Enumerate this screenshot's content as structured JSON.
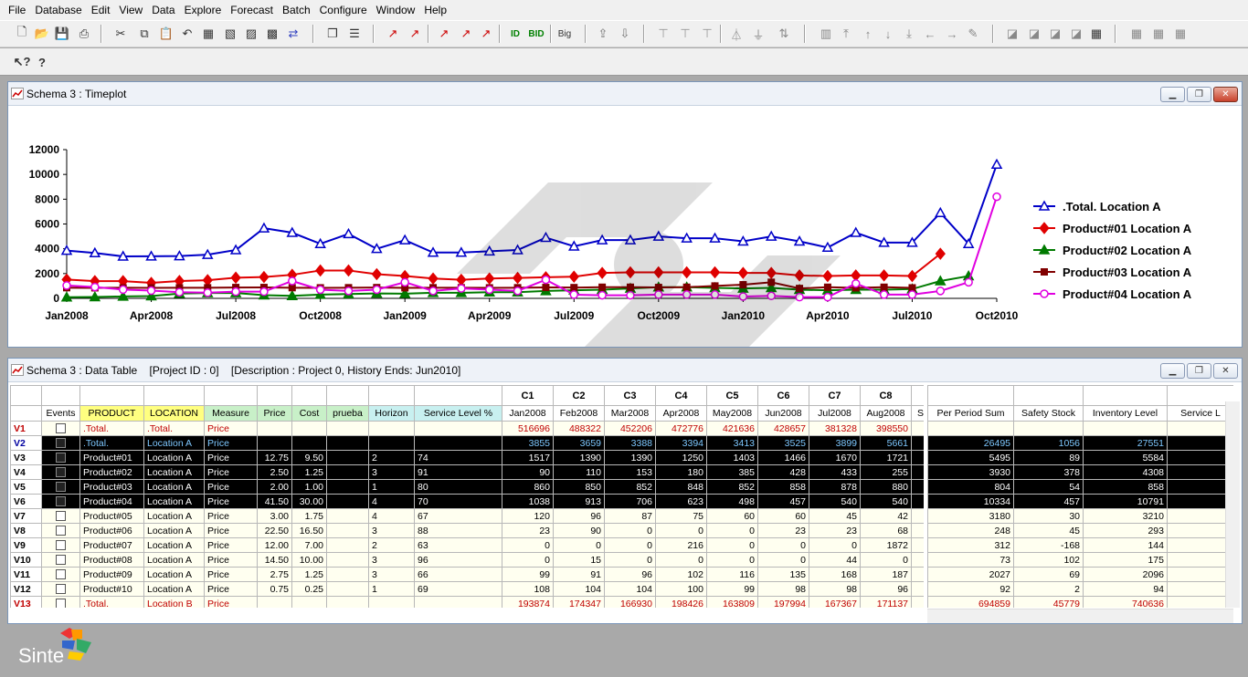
{
  "menu": [
    "File",
    "Database",
    "Edit",
    "View",
    "Data",
    "Explore",
    "Forecast",
    "Batch",
    "Configure",
    "Window",
    "Help"
  ],
  "toolbar": {
    "big_label": "Big"
  },
  "chart_window": {
    "title": "Schema 3 : Timeplot"
  },
  "table_window": {
    "title": "Schema 3 : Data Table    [Project ID : 0]    [Description : Project 0, History Ends: Jun2010]"
  },
  "window_buttons": {
    "minimize": "▁",
    "maximize": "❐",
    "close": "✕"
  },
  "chart_data": {
    "type": "line",
    "x": [
      "Jan2008",
      "Feb2008",
      "Mar2008",
      "Apr2008",
      "May2008",
      "Jun2008",
      "Jul2008",
      "Aug2008",
      "Sep2008",
      "Oct2008",
      "Nov2008",
      "Dec2008",
      "Jan2009",
      "Feb2009",
      "Mar2009",
      "Apr2009",
      "May2009",
      "Jun2009",
      "Jul2009",
      "Aug2009",
      "Sep2009",
      "Oct2009",
      "Nov2009",
      "Dec2009",
      "Jan2010",
      "Feb2010",
      "Mar2010",
      "Apr2010",
      "May2010",
      "Jun2010",
      "Jul2010",
      "Aug2010",
      "Sep2010",
      "Oct2010"
    ],
    "xticks": [
      "Jan2008",
      "Apr2008",
      "Jul2008",
      "Oct2008",
      "Jan2009",
      "Apr2009",
      "Jul2009",
      "Oct2009",
      "Jan2010",
      "Apr2010",
      "Jul2010",
      "Oct2010"
    ],
    "ylim": [
      0,
      12000
    ],
    "yticks": [
      "0",
      "2000",
      "4000",
      "6000",
      "8000",
      "10000",
      "12000"
    ],
    "legend_position": "right",
    "series": [
      {
        "name": ".Total. Location A",
        "color": "#0000c8",
        "marker": "triangle",
        "values": [
          3855,
          3659,
          3388,
          3394,
          3413,
          3525,
          3899,
          5661,
          5300,
          4400,
          5200,
          4000,
          4700,
          3700,
          3700,
          3800,
          3900,
          4900,
          4200,
          4700,
          4700,
          5000,
          4850,
          4850,
          4600,
          5000,
          4600,
          4100,
          5300,
          4500,
          4500,
          6900,
          4400,
          10800
        ]
      },
      {
        "name": "Product#01 Location A",
        "color": "#e00000",
        "marker": "diamond",
        "values": [
          1517,
          1390,
          1390,
          1250,
          1403,
          1466,
          1670,
          1721,
          1900,
          2250,
          2250,
          1950,
          1800,
          1600,
          1500,
          1600,
          1650,
          1700,
          1750,
          2050,
          2100,
          2100,
          2100,
          2100,
          2050,
          2050,
          1850,
          1800,
          1850,
          1850,
          1800,
          3600,
          null,
          null
        ]
      },
      {
        "name": "Product#02 Location A",
        "color": "#007a00",
        "marker": "triangle",
        "values": [
          90,
          110,
          153,
          180,
          385,
          428,
          433,
          255,
          200,
          300,
          350,
          400,
          380,
          450,
          450,
          500,
          500,
          600,
          650,
          700,
          800,
          900,
          900,
          850,
          800,
          850,
          700,
          650,
          700,
          700,
          750,
          1400,
          1800,
          null
        ]
      },
      {
        "name": "Product#03 Location A",
        "color": "#800000",
        "marker": "square",
        "values": [
          860,
          850,
          852,
          848,
          852,
          858,
          878,
          880,
          860,
          850,
          860,
          870,
          850,
          860,
          860,
          850,
          860,
          880,
          870,
          900,
          900,
          880,
          900,
          1000,
          1100,
          1300,
          800,
          900,
          850,
          900,
          850,
          null,
          null,
          null
        ]
      },
      {
        "name": "Product#04 Location A",
        "color": "#e000e0",
        "marker": "circle",
        "values": [
          1038,
          913,
          706,
          623,
          498,
          457,
          540,
          540,
          1400,
          700,
          600,
          700,
          1300,
          600,
          800,
          700,
          600,
          1500,
          300,
          250,
          250,
          300,
          300,
          300,
          150,
          200,
          100,
          100,
          1200,
          300,
          300,
          600,
          1300,
          8200
        ]
      }
    ]
  },
  "table": {
    "col_letters": [
      "",
      "",
      "",
      "",
      "",
      "",
      "",
      "",
      "",
      "",
      "C1",
      "C2",
      "C3",
      "C4",
      "C5",
      "C6",
      "C7",
      "C8",
      ""
    ],
    "headers": [
      "",
      "Events",
      "PRODUCT",
      "LOCATION",
      "Measure",
      "Price",
      "Cost",
      "prueba",
      "Horizon",
      "Service Level %",
      "Jan2008",
      "Feb2008",
      "Mar2008",
      "Apr2008",
      "May2008",
      "Jun2008",
      "Jul2008",
      "Aug2008",
      "S"
    ],
    "right_headers": [
      "Per Period Sum",
      "Safety Stock",
      "Inventory Level",
      "Service L"
    ],
    "rows": [
      {
        "id": "V1",
        "style": "red",
        "cells": [
          ".Total.",
          ".Total.",
          "Price",
          "",
          "",
          "",
          "",
          "",
          "516696",
          "488322",
          "452206",
          "472776",
          "421636",
          "428657",
          "381328",
          "398550"
        ],
        "right": [
          "",
          "",
          "",
          ""
        ]
      },
      {
        "id": "V2",
        "style": "sel",
        "cells": [
          ".Total.",
          "Location A",
          "Price",
          "",
          "",
          "",
          "",
          "",
          "3855",
          "3659",
          "3388",
          "3394",
          "3413",
          "3525",
          "3899",
          "5661"
        ],
        "right": [
          "26495",
          "1056",
          "27551",
          ""
        ]
      },
      {
        "id": "V3",
        "style": "dark",
        "cells": [
          "Product#01",
          "Location A",
          "Price",
          "12.75",
          "9.50",
          "",
          "2",
          "74",
          "1517",
          "1390",
          "1390",
          "1250",
          "1403",
          "1466",
          "1670",
          "1721"
        ],
        "right": [
          "5495",
          "89",
          "5584",
          ""
        ]
      },
      {
        "id": "V4",
        "style": "dark",
        "cells": [
          "Product#02",
          "Location A",
          "Price",
          "2.50",
          "1.25",
          "",
          "3",
          "91",
          "90",
          "110",
          "153",
          "180",
          "385",
          "428",
          "433",
          "255"
        ],
        "right": [
          "3930",
          "378",
          "4308",
          ""
        ]
      },
      {
        "id": "V5",
        "style": "dark",
        "cells": [
          "Product#03",
          "Location A",
          "Price",
          "2.00",
          "1.00",
          "",
          "1",
          "80",
          "860",
          "850",
          "852",
          "848",
          "852",
          "858",
          "878",
          "880"
        ],
        "right": [
          "804",
          "54",
          "858",
          ""
        ]
      },
      {
        "id": "V6",
        "style": "dark",
        "cells": [
          "Product#04",
          "Location A",
          "Price",
          "41.50",
          "30.00",
          "",
          "4",
          "70",
          "1038",
          "913",
          "706",
          "623",
          "498",
          "457",
          "540",
          "540"
        ],
        "right": [
          "10334",
          "457",
          "10791",
          ""
        ]
      },
      {
        "id": "V7",
        "style": "norm",
        "cells": [
          "Product#05",
          "Location A",
          "Price",
          "3.00",
          "1.75",
          "",
          "4",
          "67",
          "120",
          "96",
          "87",
          "75",
          "60",
          "60",
          "45",
          "42"
        ],
        "right": [
          "3180",
          "30",
          "3210",
          ""
        ]
      },
      {
        "id": "V8",
        "style": "norm",
        "cells": [
          "Product#06",
          "Location A",
          "Price",
          "22.50",
          "16.50",
          "",
          "3",
          "88",
          "23",
          "90",
          "0",
          "0",
          "0",
          "23",
          "23",
          "68"
        ],
        "right": [
          "248",
          "45",
          "293",
          ""
        ]
      },
      {
        "id": "V9",
        "style": "norm",
        "cells": [
          "Product#07",
          "Location A",
          "Price",
          "12.00",
          "7.00",
          "",
          "2",
          "63",
          "0",
          "0",
          "0",
          "216",
          "0",
          "0",
          "0",
          "1872"
        ],
        "right": [
          "312",
          "-168",
          "144",
          ""
        ]
      },
      {
        "id": "V10",
        "style": "norm",
        "cells": [
          "Product#08",
          "Location A",
          "Price",
          "14.50",
          "10.00",
          "",
          "3",
          "96",
          "0",
          "15",
          "0",
          "0",
          "0",
          "0",
          "44",
          "0"
        ],
        "right": [
          "73",
          "102",
          "175",
          ""
        ]
      },
      {
        "id": "V11",
        "style": "norm",
        "cells": [
          "Product#09",
          "Location A",
          "Price",
          "2.75",
          "1.25",
          "",
          "3",
          "66",
          "99",
          "91",
          "96",
          "102",
          "116",
          "135",
          "168",
          "187"
        ],
        "right": [
          "2027",
          "69",
          "2096",
          ""
        ]
      },
      {
        "id": "V12",
        "style": "norm",
        "cells": [
          "Product#10",
          "Location A",
          "Price",
          "0.75",
          "0.25",
          "",
          "1",
          "69",
          "108",
          "104",
          "104",
          "100",
          "99",
          "98",
          "98",
          "96"
        ],
        "right": [
          "92",
          "2",
          "94",
          ""
        ]
      },
      {
        "id": "V13",
        "style": "red",
        "cells": [
          ".Total.",
          "Location B",
          "Price",
          "",
          "",
          "",
          "",
          "",
          "193874",
          "174347",
          "166930",
          "198426",
          "163809",
          "197994",
          "167367",
          "171137"
        ],
        "right": [
          "694859",
          "45779",
          "740636",
          ""
        ]
      }
    ]
  },
  "brand": {
    "name": "Sinte"
  },
  "colors": {
    "product_hdr": "#ffff80",
    "location_hdr": "#ffff80",
    "measure_hdr": "#c8f0c8",
    "price_hdr": "#c8f0c8",
    "cost_hdr": "#c8f0c8",
    "prueba_hdr": "#c8f0c8",
    "horizon_hdr": "#c8f0f0",
    "service_hdr": "#c8f0f0"
  }
}
